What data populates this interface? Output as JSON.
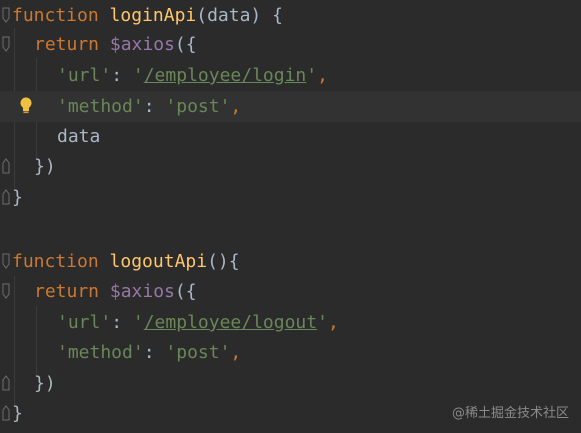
{
  "colors": {
    "background": "#2b2b2b",
    "current_line": "#323232",
    "keyword": "#cc7832",
    "function_name": "#ffc66d",
    "string": "#6a8759",
    "variable": "#9876aa",
    "default_text": "#a9b7c6",
    "bulb": "#f0c040"
  },
  "code": {
    "l1": {
      "kw": "function",
      "name": "loginApi",
      "rest": "(data) {"
    },
    "l2": {
      "kw": "return",
      "var": "$axios",
      "rest": "({"
    },
    "l3": {
      "key": "'url'",
      "sep": ": ",
      "q1": "'",
      "url": "/employee/login",
      "q2": "'",
      "comma": ","
    },
    "l4": {
      "key": "'method'",
      "sep": ": ",
      "val": "'post'",
      "comma": ","
    },
    "l5": {
      "text": "data"
    },
    "l6": {
      "text": "})"
    },
    "l7": {
      "text": "}"
    },
    "l9": {
      "kw": "function",
      "name": "logoutApi",
      "rest": "(){"
    },
    "l10": {
      "kw": "return",
      "var": "$axios",
      "rest": "({"
    },
    "l11": {
      "key": "'url'",
      "sep": ": ",
      "q1": "'",
      "url": "/employee/logout",
      "q2": "'",
      "comma": ","
    },
    "l12": {
      "key": "'method'",
      "sep": ": ",
      "val": "'post'",
      "comma": ","
    },
    "l13": {
      "text": "})"
    },
    "l14": {
      "text": "}"
    }
  },
  "watermark": "@稀土掘金技术社区",
  "icons": {
    "bulb": "lightbulb-icon",
    "fold": "fold-marker-icon"
  }
}
